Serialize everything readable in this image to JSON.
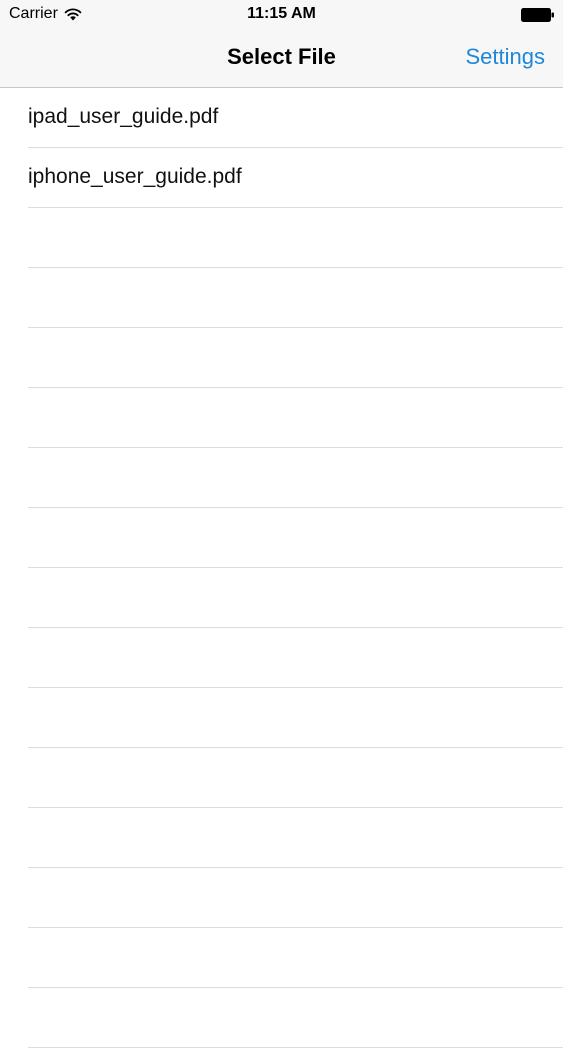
{
  "status_bar": {
    "carrier": "Carrier",
    "time": "11:15 AM",
    "wifi_icon": "wifi-icon",
    "battery_icon": "battery-icon"
  },
  "nav_bar": {
    "title": "Select File",
    "settings_label": "Settings",
    "accent_color": "#1e87d9"
  },
  "files": [
    {
      "name": "ipad_user_guide.pdf"
    },
    {
      "name": "iphone_user_guide.pdf"
    },
    {
      "name": ""
    },
    {
      "name": ""
    },
    {
      "name": ""
    },
    {
      "name": ""
    },
    {
      "name": ""
    },
    {
      "name": ""
    },
    {
      "name": ""
    },
    {
      "name": ""
    },
    {
      "name": ""
    },
    {
      "name": ""
    },
    {
      "name": ""
    },
    {
      "name": ""
    },
    {
      "name": ""
    },
    {
      "name": ""
    }
  ]
}
